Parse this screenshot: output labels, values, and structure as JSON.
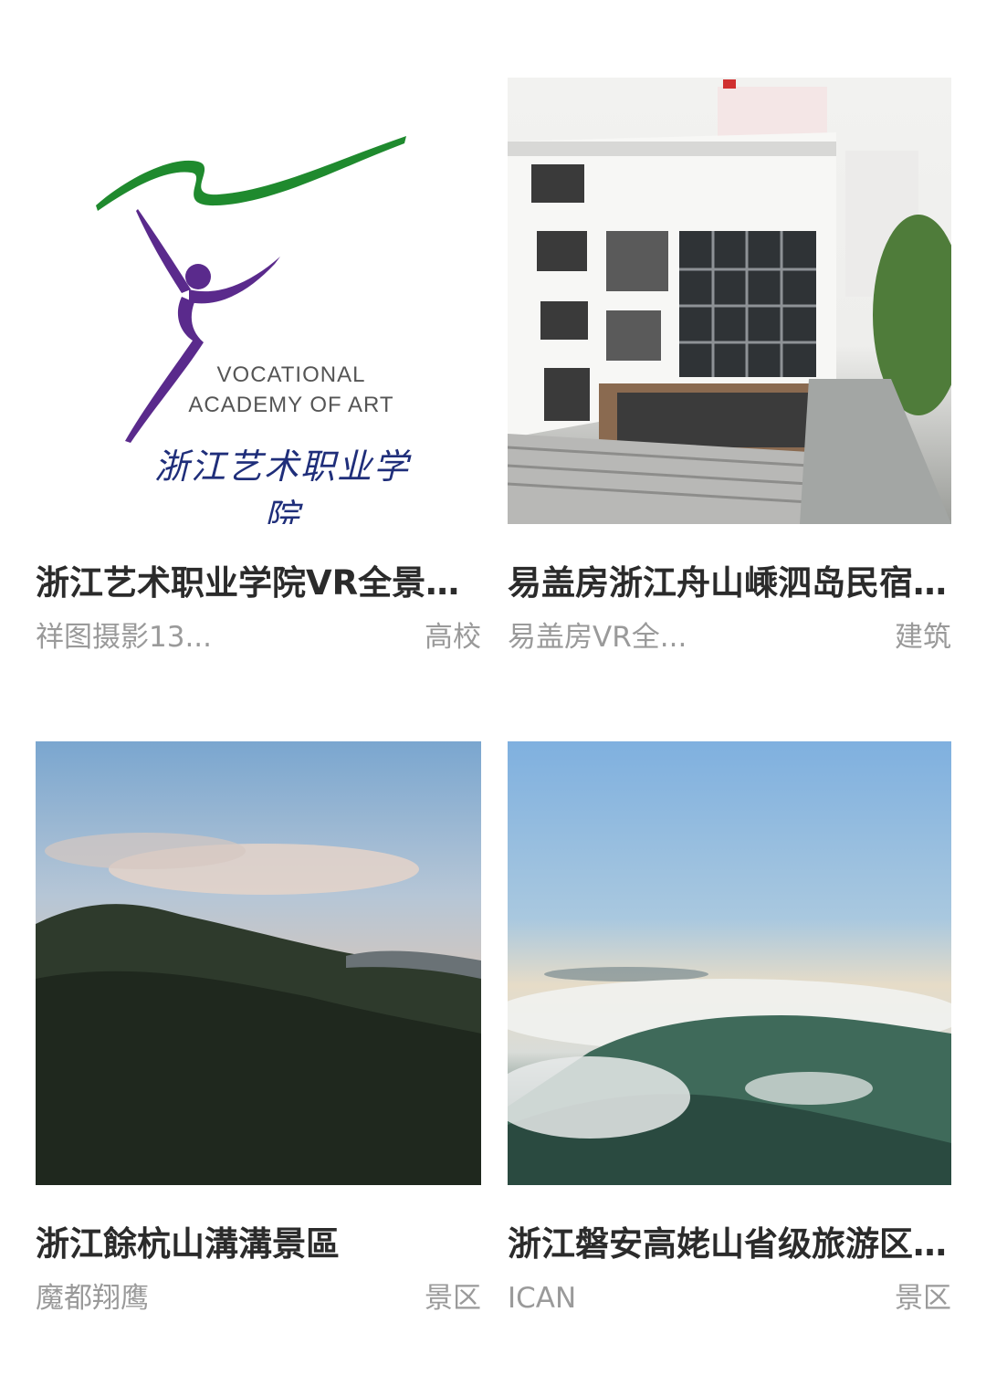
{
  "cards": [
    {
      "title": "浙江艺术职业学院VR全景漫...",
      "author": "祥图摄影13...",
      "category": "高校",
      "thumbnail": {
        "icon": "academy-logo",
        "logo_text_en_1": "VOCATIONAL",
        "logo_text_en_2": "ACADEMY OF ART",
        "logo_text_cn": "浙江艺术职业学院"
      }
    },
    {
      "title": "易盖房浙江舟山嵊泗岛民宿...",
      "author": "易盖房VR全...",
      "category": "建筑",
      "thumbnail": {
        "icon": "building-photo"
      }
    },
    {
      "title": "浙江餘杭山溝溝景區",
      "author": "魔都翔鹰",
      "category": "景区",
      "thumbnail": {
        "icon": "mountain-dusk-photo"
      }
    },
    {
      "title": "浙江磐安高姥山省级旅游区...",
      "author": "ICAN",
      "category": "景区",
      "thumbnail": {
        "icon": "sea-of-clouds-photo"
      }
    }
  ],
  "colors": {
    "title": "#2b2b2b",
    "meta": "#9a9a9a",
    "logo_green": "#1f8a2e",
    "logo_purple": "#5a2a8c",
    "logo_blue": "#1f2e7a"
  }
}
